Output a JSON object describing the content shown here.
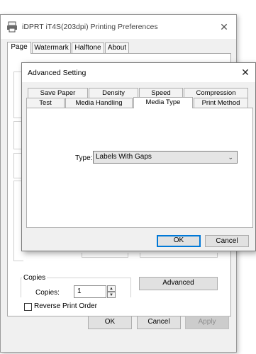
{
  "main_window": {
    "title": "iDPRT iT4S(203dpi) Printing Preferences",
    "close_glyph": "✕",
    "tabs": [
      "Page",
      "Watermark",
      "Halftone",
      "About"
    ],
    "copies": {
      "group_title": "Copies",
      "label": "Copies:",
      "value": "1",
      "spin_up": "▲",
      "spin_down": "▼"
    },
    "reverse_print_order_label": "Reverse Print Order",
    "advanced_button": "Advanced",
    "ok_button": "OK",
    "cancel_button": "Cancel",
    "apply_button": "Apply"
  },
  "advanced_dialog": {
    "title": "Advanced Setting",
    "close_glyph": "✕",
    "tabs_row1": [
      "Save Paper",
      "Density",
      "Speed",
      "Compression"
    ],
    "tabs_row2": [
      "Test",
      "Media Handling",
      "Media Type",
      "Print Method"
    ],
    "active_tab": "Media Type",
    "type_label": "Type:",
    "type_value": "Labels With Gaps",
    "dropdown_chevron": "⌄",
    "ok_button": "OK",
    "cancel_button": "Cancel"
  },
  "colors": {
    "highlight": "#e0352b",
    "focus": "#0078d7"
  }
}
